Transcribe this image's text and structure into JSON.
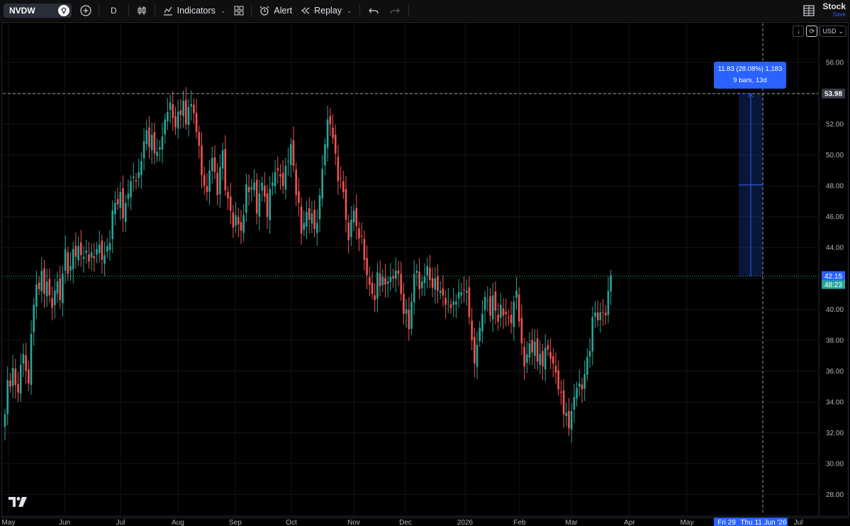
{
  "toolbar": {
    "symbol": "NVDW",
    "interval": "D",
    "indicators_label": "Indicators",
    "alert_label": "Alert",
    "replay_label": "Replay",
    "layout_name": "Stock",
    "save_label": "Save",
    "currency": "USD"
  },
  "measure": {
    "line1": "11.83 (28.08%) 1,183",
    "line2": "9 bars, 13d"
  },
  "price_labels": {
    "crosshair_price": "53.98",
    "last_price": "42.15",
    "countdown": "48:23"
  },
  "time_labels": {
    "crosshair_start": "Fri 29",
    "crosshair_date": "Thu 11 Jun '26"
  },
  "colors": {
    "up": "#26a69a",
    "down": "#ef5350",
    "accent": "#2962ff",
    "last_price": "#2962ff",
    "countdown": "#26a69a"
  },
  "chart_data": {
    "type": "candlestick",
    "symbol": "NVDW",
    "interval": "D",
    "ylim": [
      27,
      58
    ],
    "y_ticks": [
      28,
      30,
      32,
      34,
      36,
      38,
      40,
      42,
      44,
      46,
      48,
      50,
      52,
      54,
      56
    ],
    "y_tick_labels": [
      "28.00",
      "30.00",
      "32.00",
      "34.00",
      "36.00",
      "38.00",
      "40.00",
      "42.00",
      "44.00",
      "46.00",
      "48.00",
      "50.00",
      "52.00",
      "54.00",
      "56.00"
    ],
    "x_labels": [
      "May",
      "Jun",
      "Jul",
      "Aug",
      "Sep",
      "Oct",
      "Nov",
      "Dec",
      "2026",
      "Feb",
      "Mar",
      "Apr",
      "May",
      "Jul"
    ],
    "grid": true,
    "last_price": 42.15,
    "crosshair_price": 53.98,
    "measure_range": [
      42.15,
      53.98
    ],
    "closes": [
      33.2,
      35.4,
      35.0,
      36.2,
      35.1,
      34.6,
      36.4,
      37.1,
      36.0,
      35.2,
      38.4,
      40.3,
      41.6,
      41.3,
      42.5,
      41.0,
      41.8,
      40.9,
      40.1,
      41.2,
      41.8,
      40.6,
      42.3,
      43.9,
      42.3,
      42.8,
      43.9,
      43.4,
      44.1,
      43.5,
      43.4,
      43.8,
      43.1,
      43.7,
      43.3,
      43.9,
      44.2,
      43.2,
      43.5,
      44.1,
      44.3,
      46.4,
      46.9,
      46.8,
      47.6,
      45.9,
      46.9,
      47.5,
      48.3,
      48.6,
      48.3,
      48.9,
      49.6,
      50.9,
      51.6,
      50.5,
      51.3,
      50.1,
      50.2,
      50.5,
      51.2,
      52.3,
      52.8,
      53.4,
      52.4,
      51.8,
      52.8,
      52.6,
      53.5,
      52.0,
      53.1,
      53.3,
      52.7,
      51.5,
      50.6,
      48.7,
      48.0,
      47.6,
      49.0,
      49.8,
      48.9,
      47.4,
      49.2,
      50.3,
      47.7,
      47.2,
      46.4,
      45.3,
      46.1,
      45.5,
      45.1,
      46.1,
      48.1,
      47.6,
      47.9,
      48.2,
      46.2,
      47.5,
      48.2,
      47.3,
      46.0,
      47.8,
      48.2,
      48.9,
      49.0,
      48.6,
      48.0,
      49.3,
      49.6,
      50.7,
      49.3,
      47.4,
      46.9,
      44.9,
      45.6,
      46.3,
      45.8,
      46.2,
      45.2,
      45.6,
      47.4,
      49.1,
      50.7,
      52.3,
      52.0,
      51.1,
      50.1,
      48.3,
      48.5,
      47.6,
      45.8,
      44.5,
      45.8,
      46.4,
      45.4,
      44.6,
      44.7,
      43.2,
      42.2,
      41.6,
      41.0,
      40.6,
      42.4,
      41.5,
      42.1,
      41.6,
      41.8,
      42.1,
      42.0,
      42.5,
      42.3,
      41.0,
      39.7,
      40.0,
      38.7,
      40.5,
      42.3,
      42.5,
      41.3,
      41.8,
      42.1,
      42.8,
      41.9,
      41.4,
      42.0,
      41.2,
      41.2,
      40.9,
      40.3,
      40.5,
      40.1,
      40.5,
      40.5,
      41.1,
      41.1,
      41.3,
      41.2,
      39.5,
      38.0,
      36.5,
      37.7,
      38.8,
      39.7,
      40.8,
      40.6,
      39.6,
      40.9,
      39.9,
      39.2,
      40.3,
      39.6,
      39.7,
      39.4,
      39.1,
      40.5,
      41.2,
      39.2,
      37.8,
      36.3,
      37.1,
      37.8,
      37.2,
      37.9,
      36.6,
      37.1,
      36.3,
      37.5,
      37.4,
      36.8,
      36.5,
      35.9,
      34.8,
      34.6,
      33.2,
      33.3,
      32.3,
      33.4,
      34.3,
      34.9,
      35.2,
      34.8,
      35.8,
      36.9,
      37.3,
      39.5,
      39.8,
      39.3,
      39.8,
      39.8,
      39.6,
      41.2,
      42.2
    ]
  }
}
